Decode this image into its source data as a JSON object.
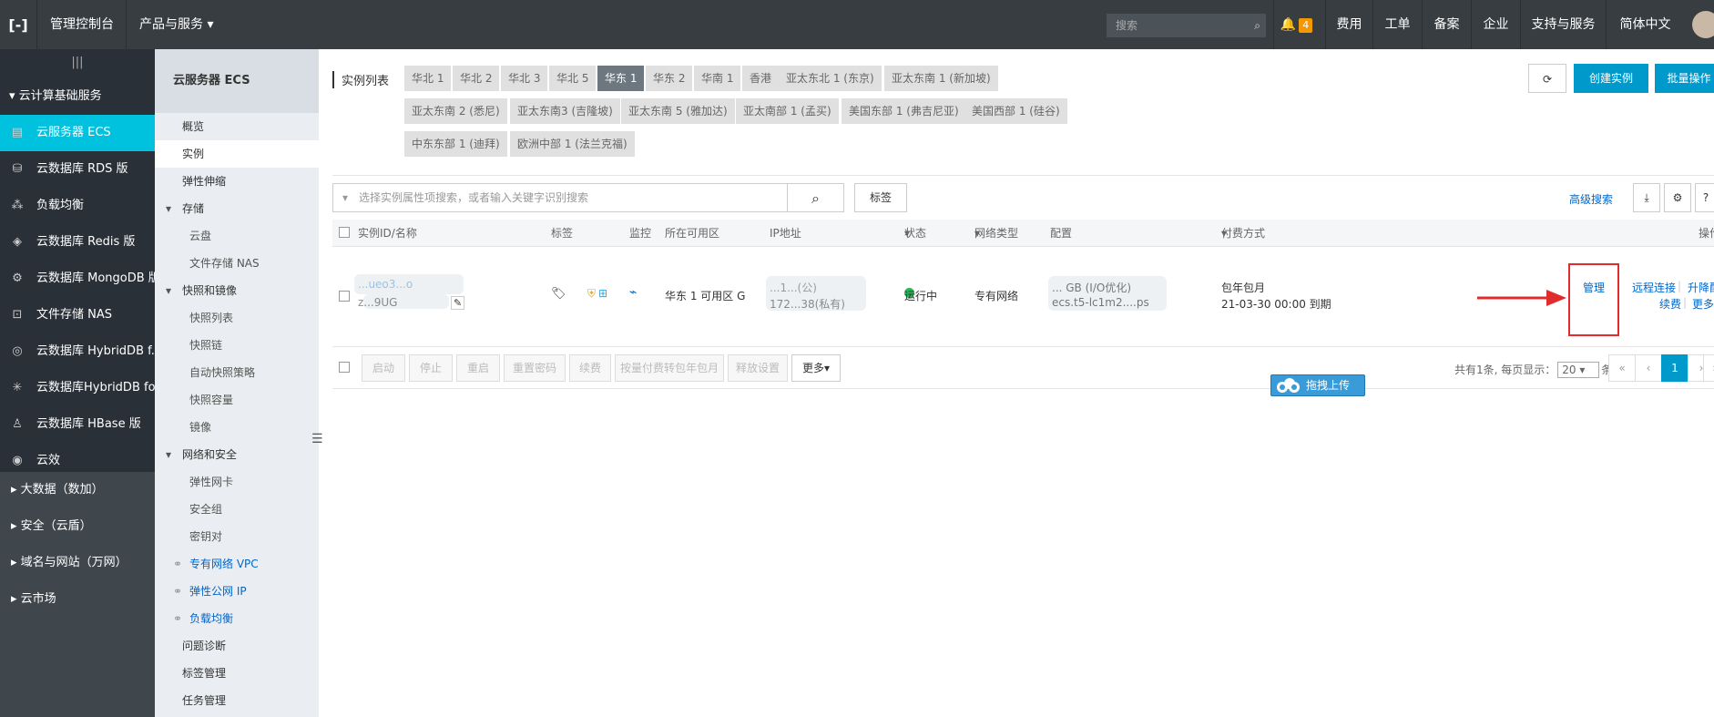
{
  "topbar": {
    "logo": "[-]",
    "console": "管理控制台",
    "products": "产品与服务",
    "search_placeholder": "搜索",
    "notify_count": "4",
    "items": [
      "费用",
      "工单",
      "备案",
      "企业",
      "支持与服务",
      "简体中文"
    ]
  },
  "sidebar": {
    "collapse_glyph": "|||",
    "group": "云计算基础服务",
    "items": [
      {
        "label": "云服务器 ECS",
        "icon": "server-icon"
      },
      {
        "label": "云数据库 RDS 版",
        "icon": "database-icon"
      },
      {
        "label": "负载均衡",
        "icon": "load-balancer-icon"
      },
      {
        "label": "云数据库 Redis 版",
        "icon": "redis-icon"
      },
      {
        "label": "云数据库 MongoDB 版",
        "icon": "mongodb-icon"
      },
      {
        "label": "文件存储 NAS",
        "icon": "storage-icon"
      },
      {
        "label": "云数据库 HybridDB f...",
        "icon": "hybriddb-icon"
      },
      {
        "label": "云数据库HybridDB fo...",
        "icon": "hybriddb2-icon"
      },
      {
        "label": "云数据库 HBase 版",
        "icon": "hbase-icon"
      },
      {
        "label": "云效",
        "icon": "eye-icon"
      }
    ],
    "folds": [
      "大数据（数加）",
      "安全（云盾）",
      "域名与网站（万网）",
      "云市场"
    ]
  },
  "subnav": {
    "title": "云服务器 ECS",
    "items": [
      "概览",
      "实例",
      "弹性伸缩"
    ],
    "storage_group": "存储",
    "storage": [
      "云盘",
      "文件存储 NAS"
    ],
    "snapshot_group": "快照和镜像",
    "snapshot": [
      "快照列表",
      "快照链",
      "自动快照策略",
      "快照容量",
      "镜像"
    ],
    "network_group": "网络和安全",
    "network": [
      "弹性网卡",
      "安全组",
      "密钥对"
    ],
    "links": [
      "专有网络 VPC",
      "弹性公网 IP",
      "负载均衡"
    ],
    "tail": [
      "问题诊断",
      "标签管理",
      "任务管理"
    ]
  },
  "main": {
    "region_label": "实例列表",
    "regions_row1": [
      "华北 1",
      "华北 2",
      "华北 3",
      "华北 5",
      "华东 1",
      "华东 2",
      "华南 1",
      "香港",
      "亚太东北 1 (东京)",
      "亚太东南 1 (新加坡)"
    ],
    "regions_row2": [
      "亚太东南 2 (悉尼)",
      "亚太东南3 (吉隆坡)",
      "亚太东南 5 (雅加达)",
      "亚太南部 1 (孟买)",
      "美国东部 1 (弗吉尼亚)",
      "美国西部 1 (硅谷)"
    ],
    "regions_row3": [
      "中东东部 1 (迪拜)",
      "欧洲中部 1 (法兰克福)"
    ],
    "btn_create": "创建实例",
    "btn_batch": "批量操作",
    "search_placeholder": "选择实例属性项搜索，或者输入关键字识别搜索",
    "tag_btn": "标签",
    "advanced": "高级搜索",
    "columns": [
      "实例ID/名称",
      "标签",
      "监控",
      "所在可用区",
      "IP地址",
      "状态",
      "网络类型",
      "配置",
      "付费方式",
      "操作"
    ],
    "row": {
      "id_line1": "...ueo3...o",
      "id_line2": "z...9UG",
      "zone": "华东 1 可用区 G",
      "ip_public": "...1...(公)",
      "ip_private": "172...38(私有)",
      "status": "运行中",
      "network": "专有网络",
      "config_line1": "... GB (I/O优化)",
      "config_line2": "ecs.t5-lc1m2....ps",
      "pay_line1": "包年包月",
      "pay_line2": "21-03-30 00:00 到期",
      "op_manage": "管理",
      "op_remote": "远程连接",
      "op_upgrade": "升降配",
      "op_renew": "续费",
      "op_more": "更多"
    },
    "footer_btns": [
      "启动",
      "停止",
      "重启",
      "重置密码",
      "续费",
      "按量付费转包年包月",
      "释放设置",
      "更多▾"
    ],
    "page_info_pre": "共有1条, 每页显示：",
    "page_size": "20",
    "page_info_post": "条",
    "page_current": "1",
    "upload_label": "拖拽上传"
  },
  "colors": {
    "topbar": "#373d41",
    "sidebar": "#293038",
    "active": "#00c1de",
    "primary": "#0099cc",
    "running": "#2ab55a",
    "highlight": "#e02c2c"
  }
}
